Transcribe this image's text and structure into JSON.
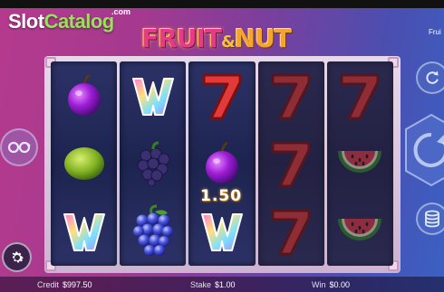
{
  "watermark": {
    "slot": "Slot",
    "catalog": "Catalog",
    "com": ".com"
  },
  "logo": {
    "fruit": "FRUIT",
    "amp": "&",
    "nut": "NUT"
  },
  "header": {
    "game_name_short": "Frui"
  },
  "reels": [
    [
      "plum",
      "lime",
      "w-wild"
    ],
    [
      "w-wild",
      "blackberry",
      "grapes"
    ],
    [
      "seven",
      "plum",
      "w-wild"
    ],
    [
      "seven",
      "seven",
      "seven"
    ],
    [
      "seven",
      "watermelon",
      "watermelon"
    ]
  ],
  "dimmed_reels": [
    4,
    5
  ],
  "win_label": "1.50",
  "status": {
    "credit_label": "Credit",
    "credit_value": "$997.50",
    "stake_label": "Stake",
    "stake_value": "$1.00",
    "win_label": "Win",
    "win_value": "$0.00"
  },
  "icons": {
    "autoplay": "autoplay-icon",
    "spin": "spin-icon",
    "coins": "coins-icon",
    "settings": "gear-icon",
    "refresh": "refresh-icon"
  },
  "colors": {
    "accent_green": "#9be05a",
    "bg_pink": "#b53a8e",
    "bg_blue": "#3a61c4"
  }
}
